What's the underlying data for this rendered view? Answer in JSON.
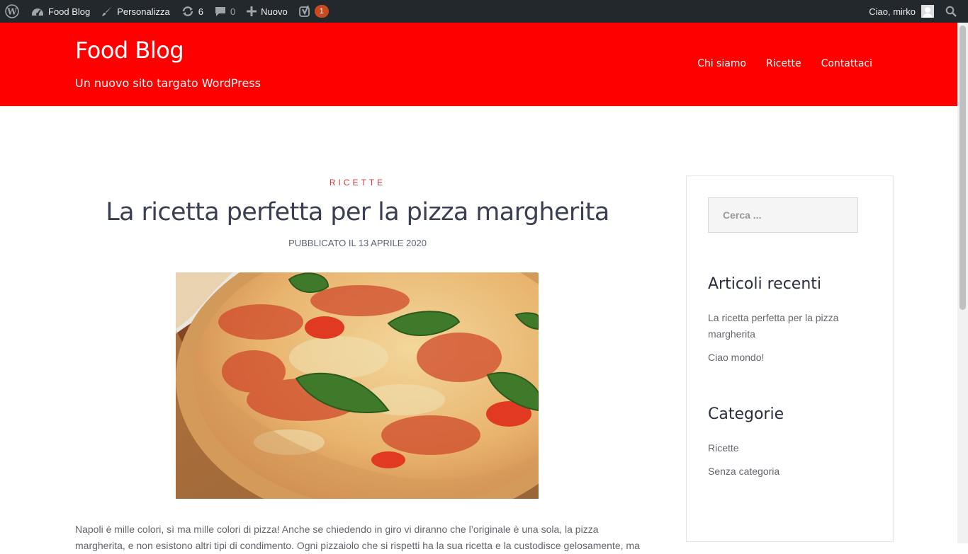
{
  "adminbar": {
    "site_name": "Food Blog",
    "customize": "Personalizza",
    "updates_count": "6",
    "comments_count": "0",
    "new_label": "Nuovo",
    "yoast_badge": "1",
    "greeting": "Ciao, mirko"
  },
  "header": {
    "title": "Food Blog",
    "description": "Un nuovo sito targato WordPress",
    "nav": [
      "Chi siamo",
      "Ricette",
      "Contattaci"
    ]
  },
  "post": {
    "category": "RICETTE",
    "title": "La ricetta perfetta per la pizza margherita",
    "meta": "PUBBLICATO IL 13 APRILE 2020",
    "content": "Napoli è mille colori, sì ma mille colori di pizza! Anche se chiedendo in giro vi diranno che l’originale è una sola, la pizza margherita, e non esistono altri tipi di condimento. Ogni pizzaiolo che si rispetti ha la sua ricetta e la custodisce gelosamente, ma"
  },
  "sidebar": {
    "search_placeholder": "Cerca ...",
    "recent_title": "Articoli recenti",
    "recent": [
      "La ricetta perfetta per la pizza margherita",
      "Ciao mondo!"
    ],
    "categories_title": "Categorie",
    "categories": [
      "Ricette",
      "Senza categoria"
    ]
  },
  "colors": {
    "header_bg": "#ff0000",
    "adminbar_bg": "#23282d",
    "category_accent": "#d9373c"
  }
}
